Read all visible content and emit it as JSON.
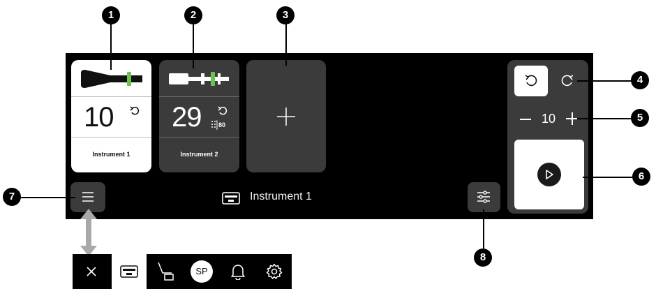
{
  "tiles": [
    {
      "number": "10",
      "name": "Instrument 1",
      "active": true
    },
    {
      "number": "29",
      "badge": "80",
      "name": "Instrument 2",
      "active": false
    }
  ],
  "controls": {
    "count": "10"
  },
  "bottom": {
    "title": "Instrument 1"
  },
  "callouts": [
    "1",
    "2",
    "3",
    "4",
    "5",
    "6",
    "7",
    "8"
  ],
  "toolbar": {
    "sp_label": "SP"
  },
  "icons": {
    "instrument": "instrument-icon",
    "undo": "rotate-ccw-icon",
    "redo": "rotate-cw-icon",
    "add": "plus-icon",
    "minus": "minus-icon",
    "play": "play-icon",
    "menu": "hamburger-icon",
    "settings": "sliders-icon",
    "display": "display-icon",
    "chair": "chair-icon",
    "bell": "bell-icon",
    "gear": "gear-icon",
    "close": "close-icon",
    "arrow": "double-arrow-icon"
  },
  "colors": {
    "accent_green": "#6cc24a",
    "tile_gray": "#3b3b3b",
    "screen": "#000000"
  }
}
